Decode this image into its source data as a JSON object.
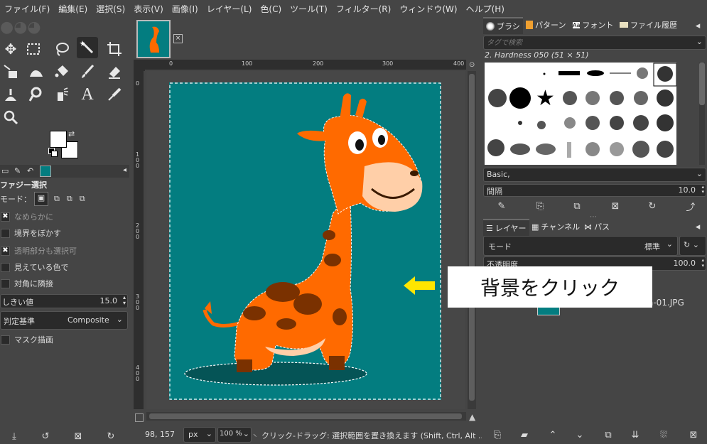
{
  "menubar": [
    "ファイル(F)",
    "編集(E)",
    "選択(S)",
    "表示(V)",
    "画像(I)",
    "レイヤー(L)",
    "色(C)",
    "ツール(T)",
    "フィルター(R)",
    "ウィンドウ(W)",
    "ヘルプ(H)"
  ],
  "tool_options": {
    "title": "ファジー選択",
    "mode_label": "モード：",
    "antialias": "なめらかに",
    "feather": "境界をぼかす",
    "transparent": "透明部分も選択可",
    "sample_merged": "見えている色で",
    "diagonal": "対角に隣接",
    "threshold_label": "しきい値",
    "threshold_value": "15.0",
    "criterion_label": "判定基準",
    "criterion_value": "Composite",
    "draw_mask": "マスク描画"
  },
  "status": {
    "coords": "98, 157",
    "unit": "px",
    "zoom": "100 %",
    "message": "クリック-ドラッグ: 選択範囲を置き換えます (Shift, Ctrl, Alt ..."
  },
  "rulers": {
    "top": [
      "0",
      "100",
      "200",
      "300",
      "400"
    ],
    "left": [
      "0",
      "1\n0\n0",
      "2\n0\n0",
      "3\n0\n0",
      "4\n0\n0"
    ]
  },
  "dock": {
    "tabs": [
      "ブラシ",
      "パターン",
      "フォント",
      "ファイル履歴"
    ],
    "filter_placeholder": "タグで検索",
    "brush_name": "2. Hardness 050 (51 × 51)",
    "preset": "Basic,",
    "spacing_label": "間隔",
    "spacing_value": "10.0",
    "layers_tabs": [
      "レイヤー",
      "チャンネル",
      "パス"
    ],
    "mode_label": "モード",
    "mode_value": "標準",
    "opacity_label": "不透明度",
    "opacity_value": "100.0",
    "layer_name": "a-01.JPG"
  },
  "callout": "背景をクリック",
  "colors": {
    "teal": "#037d80",
    "orange": "#ff6a00",
    "arrow": "#ffe600"
  }
}
